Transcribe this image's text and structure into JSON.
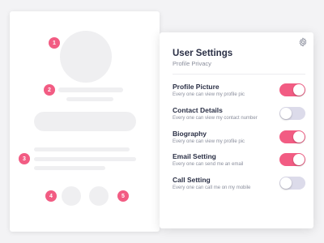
{
  "wireframe": {
    "markers": [
      "1",
      "2",
      "3",
      "4",
      "5"
    ]
  },
  "settings": {
    "title": "User Settings",
    "subtitle": "Profile Privacy",
    "gear_icon": "gear-icon",
    "accent_color": "#f25c83",
    "off_color": "#dcdbea",
    "items": [
      {
        "label": "Profile Picture",
        "description": "Every one can view my profile pic",
        "enabled": true
      },
      {
        "label": "Contact Details",
        "description": "Every one can view my contact number",
        "enabled": false
      },
      {
        "label": "Biography",
        "description": "Every one can view my profile pic",
        "enabled": true
      },
      {
        "label": "Email Setting",
        "description": "Every one can send me an email",
        "enabled": true
      },
      {
        "label": "Call Setting",
        "description": "Every one can call me on my mobile",
        "enabled": false
      }
    ]
  }
}
